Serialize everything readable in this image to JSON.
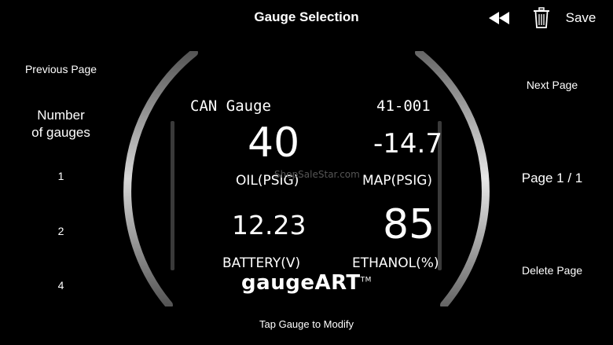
{
  "header": {
    "title": "Gauge Selection",
    "save_label": "Save"
  },
  "left_panel": {
    "previous_page": "Previous Page",
    "number_of_gauges_line1": "Number",
    "number_of_gauges_line2": "of gauges",
    "options": [
      "1",
      "2",
      "4"
    ]
  },
  "right_panel": {
    "next_page": "Next Page",
    "page_indicator": "Page 1 / 1",
    "delete_page": "Delete Page"
  },
  "gauge": {
    "title": "CAN Gauge",
    "code": "41-001",
    "readouts": [
      {
        "value": "40",
        "label": "OIL(PSIG)"
      },
      {
        "value": "-14.7",
        "label": "MAP(PSIG)"
      },
      {
        "value": "12.23",
        "label": "BATTERY(V)"
      },
      {
        "value": "85",
        "label": "ETHANOL(%)"
      }
    ],
    "brand": "gaugeART",
    "brand_mark": "TM",
    "watermark": "ShopSaleStar.com"
  },
  "footer": {
    "hint": "Tap Gauge to Modify"
  },
  "icons": {
    "rewind": "rewind-icon",
    "trash": "trash-icon"
  }
}
